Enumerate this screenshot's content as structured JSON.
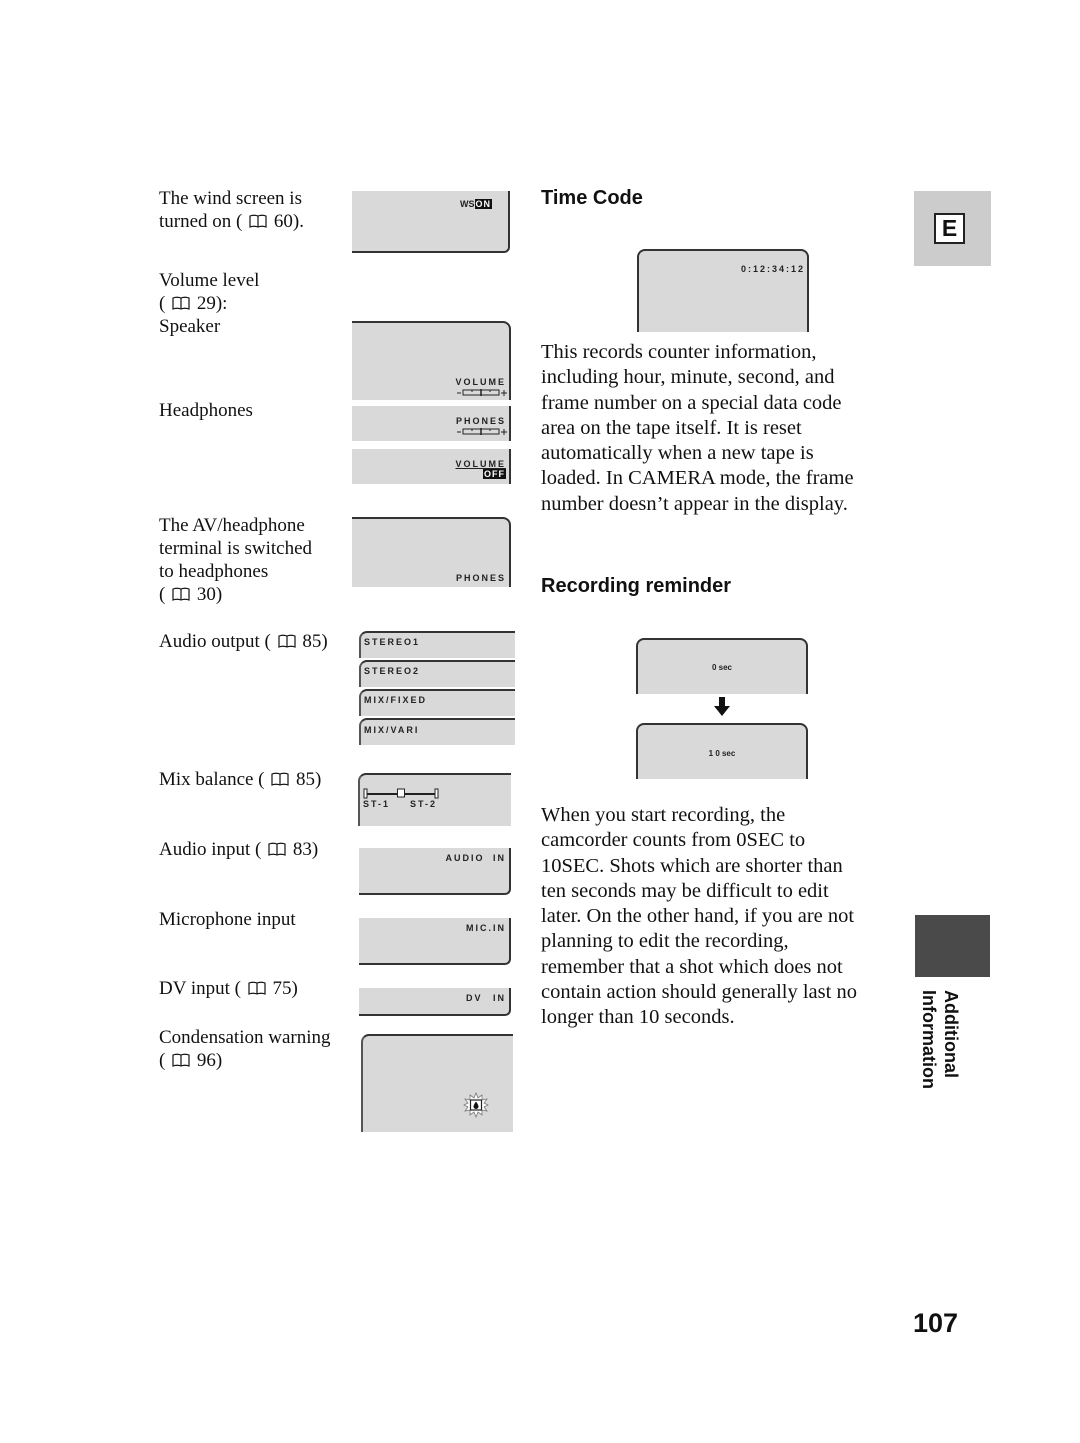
{
  "labels": {
    "wind_screen": [
      "The wind screen is",
      "turned on ("
    ],
    "wind_screen_ref": "60).",
    "volume_level": "Volume level",
    "volume_ref": "29):",
    "speaker": "Speaker",
    "headphones": "Headphones",
    "av_terminal": [
      "The AV/headphone",
      "terminal is switched",
      "to headphones"
    ],
    "av_terminal_ref": "30)",
    "audio_output": "Audio output (",
    "audio_output_ref": "85)",
    "mix_balance": "Mix balance (",
    "mix_balance_ref": "85)",
    "audio_input": "Audio input (",
    "audio_input_ref": "83)",
    "microphone_input": "Microphone input",
    "dv_input": "DV input (",
    "dv_input_ref": "75)",
    "condensation": "Condensation warning",
    "condensation_ref": "96)",
    "open_paren": "("
  },
  "screens": {
    "ws": "WS",
    "ws_on": "ON",
    "volume": "VOLUME",
    "volume_scale_minus": "-",
    "volume_scale_plus": "+",
    "phones": "PHONES",
    "volume_off_label": "VOLUME",
    "volume_off": "OFF",
    "phones_terminal": "PHONES",
    "audio_output_options": [
      "STEREO1",
      "STEREO2",
      "MIX/FIXED",
      "MIX/VARI"
    ],
    "mix_left": "ST-1",
    "mix_right": "ST-2",
    "mix_balance_position": 0.5,
    "audio_in": "AUDIO IN",
    "mic_in": "MIC.IN",
    "dv_in": "DV IN"
  },
  "time_code": {
    "heading": "Time Code",
    "display": "0:12:34:12",
    "paragraph": [
      "This records counter information,",
      "including hour, minute, second, and",
      "frame number on a special data code",
      "area on the tape itself. It is reset",
      "automatically when a new tape is",
      "loaded. In CAMERA mode, the frame",
      "number doesn’t appear in the display."
    ]
  },
  "recording_reminder": {
    "heading": "Recording reminder",
    "start": "0 sec",
    "end": "1 0 sec",
    "paragraph": [
      "When you start recording, the",
      "camcorder counts from 0SEC to",
      "10SEC. Shots which are shorter than",
      "ten seconds may be difficult to edit",
      "later. On the other hand, if you are not",
      "planning to edit the recording,",
      "remember that a shot which does not",
      "contain action should generally last no",
      "longer than 10 seconds."
    ]
  },
  "side_tab": {
    "language": "E",
    "section_line1": "Additional",
    "section_line2": "Information"
  },
  "page_number": "107",
  "icons": {
    "book": "book-icon",
    "condensation": "condensation-warning-icon",
    "arrow": "arrow-down-icon"
  }
}
